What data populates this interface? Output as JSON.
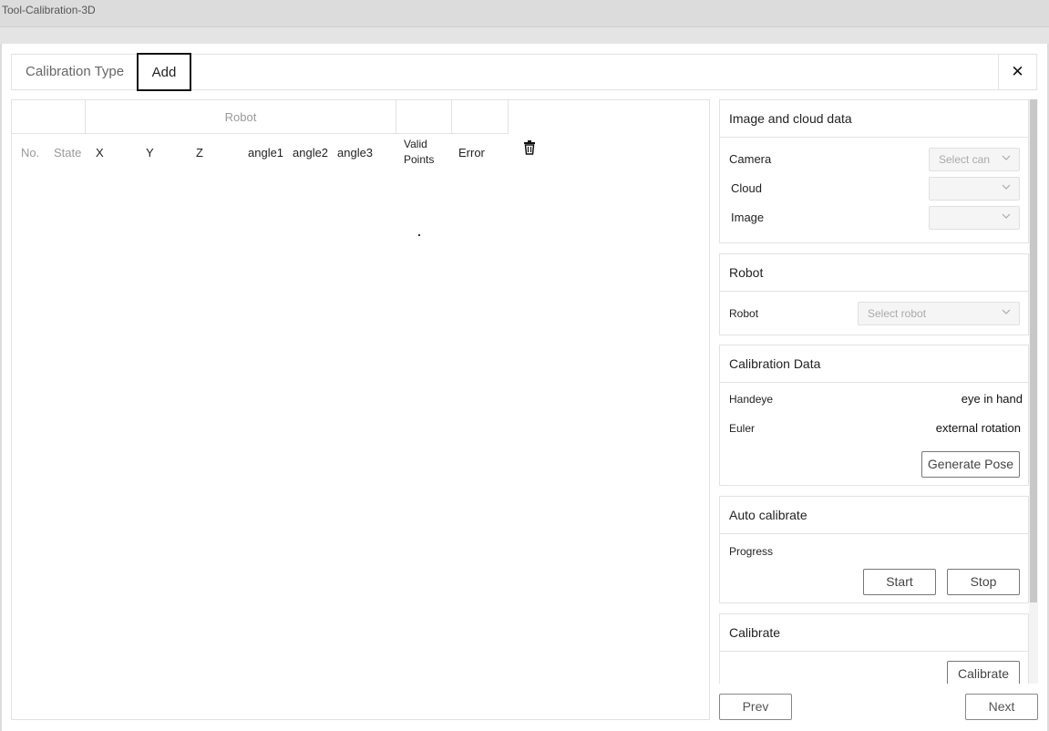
{
  "window_title": "Tool-Calibration-3D",
  "tabs": {
    "calibration_type": "Calibration Type",
    "add": "Add"
  },
  "close_symbol": "✕",
  "table": {
    "group_header": "Robot",
    "columns": [
      "No.",
      "State",
      "X",
      "Y",
      "Z",
      "angle1",
      "angle2",
      "angle3",
      "Valid Points",
      "Error"
    ],
    "valid_points_line1": "Valid",
    "valid_points_line2": "Points",
    "rows": []
  },
  "image_cloud": {
    "title": "Image and cloud data",
    "camera_label": "Camera",
    "camera_placeholder": "Select can",
    "cloud_label": "Cloud",
    "cloud_value": "",
    "image_label": "Image",
    "image_value": ""
  },
  "robot": {
    "title": "Robot",
    "robot_label": "Robot",
    "robot_placeholder": "Select robot"
  },
  "calibration_data": {
    "title": "Calibration Data",
    "handeye_label": "Handeye",
    "handeye_value": "eye in hand",
    "euler_label": "Euler",
    "euler_value": "external rotation",
    "generate_pose": "Generate Pose"
  },
  "auto_calibrate": {
    "title": "Auto calibrate",
    "progress_label": "Progress",
    "start": "Start",
    "stop": "Stop"
  },
  "calibrate": {
    "title": "Calibrate",
    "calibrate_button": "Calibrate"
  },
  "footer": {
    "prev": "Prev",
    "next": "Next"
  }
}
